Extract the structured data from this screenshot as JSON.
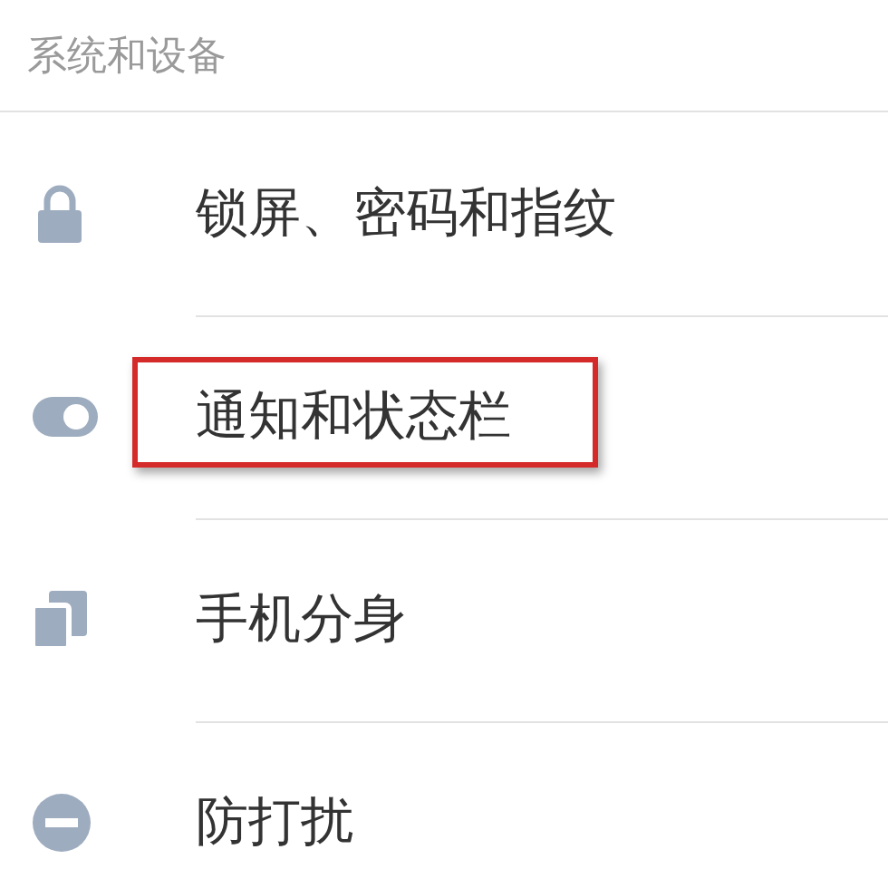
{
  "section_title": "系统和设备",
  "items": [
    {
      "label": "锁屏、密码和指纹",
      "kind": "lock",
      "highlighted": false
    },
    {
      "label": "通知和状态栏",
      "kind": "toggle",
      "highlighted": true
    },
    {
      "label": "手机分身",
      "kind": "clone",
      "highlighted": false
    },
    {
      "label": "防打扰",
      "kind": "minus",
      "highlighted": false
    }
  ]
}
